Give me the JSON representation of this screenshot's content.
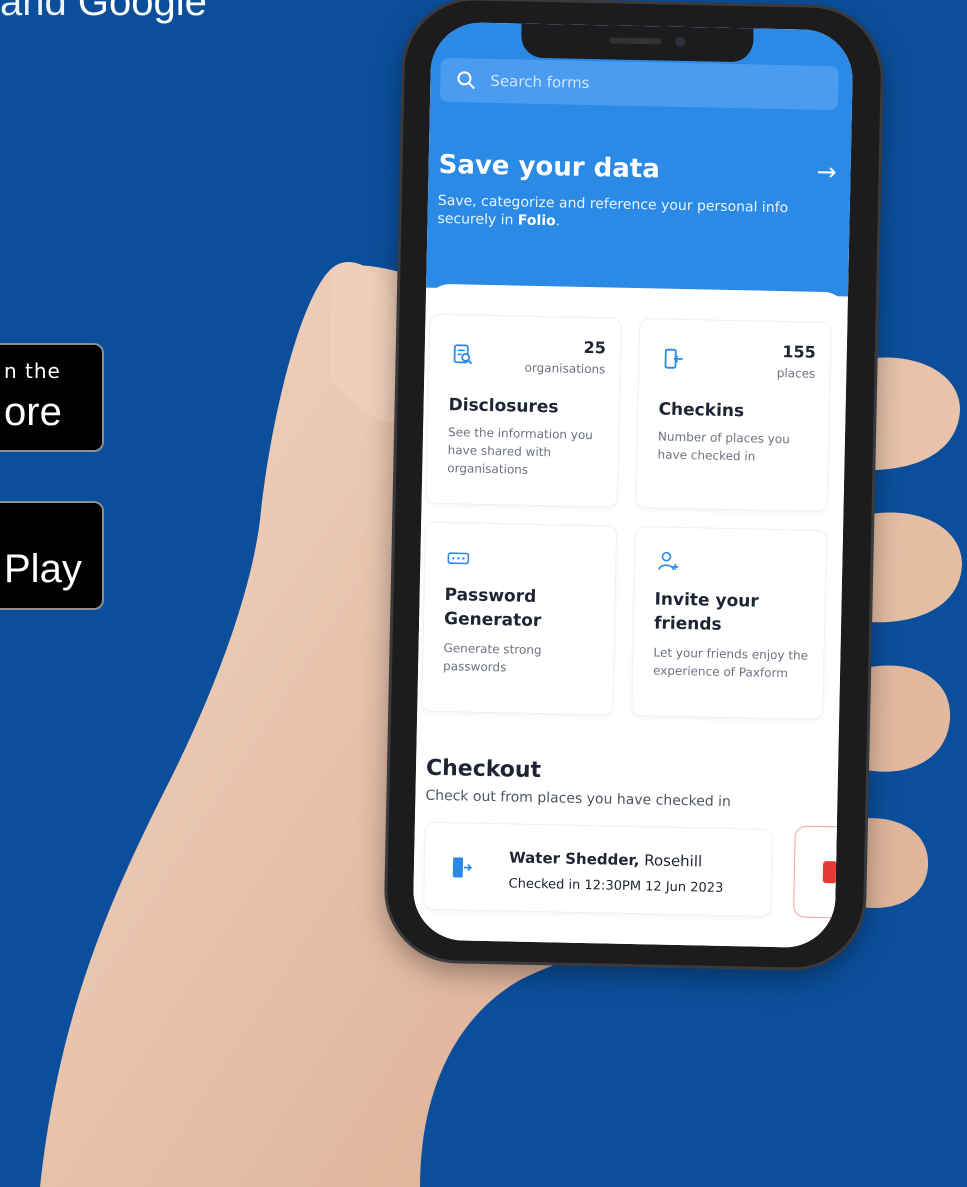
{
  "promo": {
    "headline_light": "and",
    "headline_bold": "Google",
    "app_store_small": "n the",
    "app_store_big": "ore",
    "google_play_big": "Play"
  },
  "app": {
    "search_placeholder": "Search forms",
    "hero": {
      "title": "Save your data",
      "subtitle_prefix": "Save, categorize and reference your personal info securely in ",
      "subtitle_brand": "Folio",
      "subtitle_suffix": "."
    },
    "cards": [
      {
        "icon": "document-search-icon",
        "count": "25",
        "unit": "organisations",
        "title": "Disclosures",
        "desc": "See the information you have shared with organisations"
      },
      {
        "icon": "door-enter-icon",
        "count": "155",
        "unit": "places",
        "title": "Checkins",
        "desc": "Number of places you have checked in"
      },
      {
        "icon": "password-icon",
        "count": "",
        "unit": "",
        "title": "Password Generator",
        "desc": "Generate strong passwords"
      },
      {
        "icon": "add-user-icon",
        "count": "",
        "unit": "",
        "title": "Invite your friends",
        "desc": "Let your friends enjoy the experience of Paxform"
      }
    ],
    "checkout": {
      "title": "Checkout",
      "subtitle": "Check out from places you have checked in",
      "items": [
        {
          "place_bold": "Water Shedder,",
          "place_rest": " Rosehill",
          "time": "Checked in 12:30PM 12 Jun 2023"
        }
      ]
    }
  },
  "colors": {
    "background": "#0b4f9c",
    "app_blue": "#2b8ae6",
    "accent_icon": "#2b8ae6",
    "danger": "#e53935"
  }
}
